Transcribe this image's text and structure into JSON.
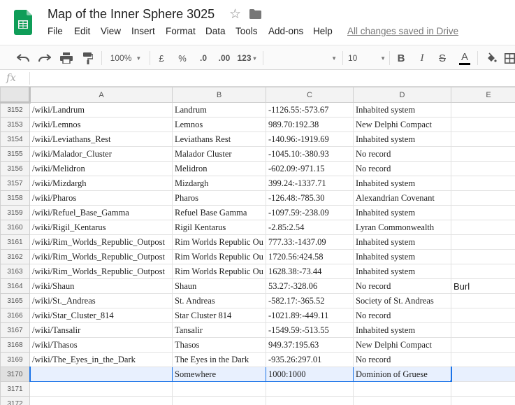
{
  "app": {
    "doc_title": "Map of the Inner Sphere 3025",
    "saved_status": "All changes saved in Drive",
    "brand_color": "#0f9d58",
    "selection_color": "#1a73e8"
  },
  "menu": [
    "File",
    "Edit",
    "View",
    "Insert",
    "Format",
    "Data",
    "Tools",
    "Add-ons",
    "Help"
  ],
  "toolbar": {
    "zoom": "100%",
    "currency": "£",
    "percent": "%",
    "decrease_decimals": ".0",
    "increase_decimals": ".00",
    "more_formats": "123",
    "font_size": "10",
    "bold": "B",
    "italic": "I",
    "strikethrough": "S",
    "text_color": "A"
  },
  "formula_bar": {
    "fx": "fx",
    "value": ""
  },
  "columns": [
    "A",
    "B",
    "C",
    "D",
    "E"
  ],
  "rows": [
    {
      "n": "3152",
      "cells": [
        "/wiki/Landrum",
        "Landrum",
        "-1126.55:-573.67",
        "Inhabited system",
        ""
      ]
    },
    {
      "n": "3153",
      "cells": [
        "/wiki/Lemnos",
        "Lemnos",
        "989.70:192.38",
        "New Delphi Compact",
        ""
      ]
    },
    {
      "n": "3154",
      "cells": [
        "/wiki/Leviathans_Rest",
        "Leviathans Rest",
        "-140.96:-1919.69",
        "Inhabited system",
        ""
      ]
    },
    {
      "n": "3155",
      "cells": [
        "/wiki/Malador_Cluster",
        "Malador Cluster",
        "-1045.10:-380.93",
        "No record",
        ""
      ]
    },
    {
      "n": "3156",
      "cells": [
        "/wiki/Melidron",
        "Melidron",
        "-602.09:-971.15",
        "No record",
        ""
      ]
    },
    {
      "n": "3157",
      "cells": [
        "/wiki/Mizdargh",
        "Mizdargh",
        "399.24:-1337.71",
        "Inhabited system",
        ""
      ]
    },
    {
      "n": "3158",
      "cells": [
        "/wiki/Pharos",
        "Pharos",
        "-126.48:-785.30",
        "Alexandrian Covenant",
        ""
      ]
    },
    {
      "n": "3159",
      "cells": [
        "/wiki/Refuel_Base_Gamma",
        "Refuel Base Gamma",
        "-1097.59:-238.09",
        "Inhabited system",
        ""
      ]
    },
    {
      "n": "3160",
      "cells": [
        "/wiki/Rigil_Kentarus",
        "Rigil Kentarus",
        "-2.85:2.54",
        "Lyran Commonwealth",
        ""
      ]
    },
    {
      "n": "3161",
      "cells": [
        "/wiki/Rim_Worlds_Republic_Outpost",
        "Rim Worlds Republic Ou",
        "777.33:-1437.09",
        "Inhabited system",
        ""
      ]
    },
    {
      "n": "3162",
      "cells": [
        "/wiki/Rim_Worlds_Republic_Outpost",
        "Rim Worlds Republic Ou",
        "1720.56:424.58",
        "Inhabited system",
        ""
      ]
    },
    {
      "n": "3163",
      "cells": [
        "/wiki/Rim_Worlds_Republic_Outpost",
        "Rim Worlds Republic Ou",
        "1628.38:-73.44",
        "Inhabited system",
        ""
      ]
    },
    {
      "n": "3164",
      "cells": [
        "/wiki/Shaun",
        "Shaun",
        "53.27:-328.06",
        "No record",
        "Burl"
      ]
    },
    {
      "n": "3165",
      "cells": [
        "/wiki/St._Andreas",
        "St. Andreas",
        "-582.17:-365.52",
        "Society of St. Andreas",
        ""
      ]
    },
    {
      "n": "3166",
      "cells": [
        "/wiki/Star_Cluster_814",
        "Star Cluster 814",
        "-1021.89:-449.11",
        "No record",
        ""
      ]
    },
    {
      "n": "3167",
      "cells": [
        "/wiki/Tansalir",
        "Tansalir",
        "-1549.59:-513.55",
        "Inhabited system",
        ""
      ]
    },
    {
      "n": "3168",
      "cells": [
        "/wiki/Thasos",
        "Thasos",
        "949.37:195.63",
        "New Delphi Compact",
        ""
      ]
    },
    {
      "n": "3169",
      "cells": [
        "/wiki/The_Eyes_in_the_Dark",
        "The Eyes in the Dark",
        "-935.26:297.01",
        "No record",
        ""
      ]
    },
    {
      "n": "3170",
      "cells": [
        "",
        "Somewhere",
        "1000:1000",
        "Dominion of Gruese",
        ""
      ],
      "selected": true
    },
    {
      "n": "3171",
      "cells": [
        "",
        "",
        "",
        "",
        ""
      ]
    },
    {
      "n": "3172",
      "cells": [
        "",
        "",
        "",
        "",
        ""
      ]
    }
  ]
}
